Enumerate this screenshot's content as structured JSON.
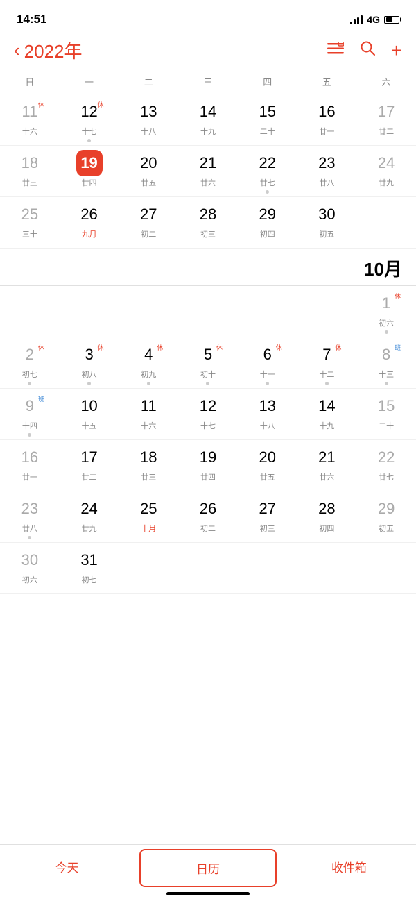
{
  "statusBar": {
    "time": "14:51",
    "signal": "4G"
  },
  "header": {
    "backLabel": "‹",
    "yearLabel": "2022年",
    "icons": {
      "list": "☰",
      "search": "⌕",
      "add": "+"
    }
  },
  "weekdays": [
    "日",
    "一",
    "二",
    "三",
    "四",
    "五",
    "六"
  ],
  "september": {
    "monthLabel": "",
    "weeks": [
      [
        {
          "day": "11",
          "lunar": "十六",
          "gray": true,
          "badge": "休",
          "dot": false
        },
        {
          "day": "12",
          "lunar": "十七",
          "gray": false,
          "badge": "休",
          "dot": true
        },
        {
          "day": "13",
          "lunar": "十八",
          "gray": false,
          "badge": "",
          "dot": false
        },
        {
          "day": "14",
          "lunar": "十九",
          "gray": false,
          "badge": "",
          "dot": false
        },
        {
          "day": "15",
          "lunar": "二十",
          "gray": false,
          "badge": "",
          "dot": false
        },
        {
          "day": "16",
          "lunar": "廿一",
          "gray": false,
          "badge": "",
          "dot": false
        },
        {
          "day": "17",
          "lunar": "廿二",
          "gray": true,
          "badge": "",
          "dot": false
        }
      ],
      [
        {
          "day": "18",
          "lunar": "廿三",
          "gray": true,
          "badge": "",
          "dot": false
        },
        {
          "day": "19",
          "lunar": "廿四",
          "gray": false,
          "badge": "",
          "today": true,
          "dot": false
        },
        {
          "day": "20",
          "lunar": "廿五",
          "gray": false,
          "badge": "",
          "dot": false
        },
        {
          "day": "21",
          "lunar": "廿六",
          "gray": false,
          "badge": "",
          "dot": false
        },
        {
          "day": "22",
          "lunar": "廿七",
          "gray": false,
          "badge": "",
          "dot": true
        },
        {
          "day": "23",
          "lunar": "廿八",
          "gray": false,
          "badge": "",
          "dot": false
        },
        {
          "day": "24",
          "lunar": "廿九",
          "gray": true,
          "badge": "",
          "dot": false
        }
      ],
      [
        {
          "day": "25",
          "lunar": "三十",
          "gray": true,
          "badge": "",
          "dot": false
        },
        {
          "day": "26",
          "lunar": "九月",
          "gray": false,
          "badge": "",
          "redLunar": true,
          "dot": false
        },
        {
          "day": "27",
          "lunar": "初二",
          "gray": false,
          "badge": "",
          "dot": false
        },
        {
          "day": "28",
          "lunar": "初三",
          "gray": false,
          "badge": "",
          "dot": false
        },
        {
          "day": "29",
          "lunar": "初四",
          "gray": false,
          "badge": "",
          "dot": false
        },
        {
          "day": "30",
          "lunar": "初五",
          "gray": false,
          "badge": "",
          "dot": false
        },
        {
          "day": "",
          "lunar": "",
          "gray": true,
          "badge": "",
          "dot": false,
          "empty": true
        }
      ]
    ]
  },
  "october": {
    "monthLabel": "10月",
    "weeks": [
      [
        {
          "day": "",
          "lunar": "",
          "empty": true,
          "dot": false
        },
        {
          "day": "",
          "lunar": "",
          "empty": true,
          "dot": false
        },
        {
          "day": "",
          "lunar": "",
          "empty": true,
          "dot": false
        },
        {
          "day": "",
          "lunar": "",
          "empty": true,
          "dot": false
        },
        {
          "day": "",
          "lunar": "",
          "empty": true,
          "dot": false
        },
        {
          "day": "",
          "lunar": "",
          "empty": true,
          "dot": false
        },
        {
          "day": "1",
          "lunar": "初六",
          "gray": true,
          "badge": "休",
          "dot": true
        }
      ],
      [
        {
          "day": "2",
          "lunar": "初七",
          "gray": true,
          "badge": "休",
          "dot": true
        },
        {
          "day": "3",
          "lunar": "初八",
          "gray": false,
          "badge": "休",
          "dot": true
        },
        {
          "day": "4",
          "lunar": "初九",
          "gray": false,
          "badge": "休",
          "dot": true
        },
        {
          "day": "5",
          "lunar": "初十",
          "gray": false,
          "badge": "休",
          "dot": true
        },
        {
          "day": "6",
          "lunar": "十一",
          "gray": false,
          "badge": "休",
          "dot": true
        },
        {
          "day": "7",
          "lunar": "十二",
          "gray": false,
          "badge": "休",
          "dot": true
        },
        {
          "day": "8",
          "lunar": "十三",
          "gray": true,
          "badge": "班",
          "banBadge": true,
          "dot": true
        }
      ],
      [
        {
          "day": "9",
          "lunar": "十四",
          "gray": true,
          "badge": "班",
          "banBadge": true,
          "dot": true
        },
        {
          "day": "10",
          "lunar": "十五",
          "gray": false,
          "badge": "",
          "dot": false
        },
        {
          "day": "11",
          "lunar": "十六",
          "gray": false,
          "badge": "",
          "dot": false
        },
        {
          "day": "12",
          "lunar": "十七",
          "gray": false,
          "badge": "",
          "dot": false
        },
        {
          "day": "13",
          "lunar": "十八",
          "gray": false,
          "badge": "",
          "dot": false
        },
        {
          "day": "14",
          "lunar": "十九",
          "gray": false,
          "badge": "",
          "dot": false
        },
        {
          "day": "15",
          "lunar": "二十",
          "gray": true,
          "badge": "",
          "dot": false
        }
      ],
      [
        {
          "day": "16",
          "lunar": "廿一",
          "gray": true,
          "badge": "",
          "dot": false
        },
        {
          "day": "17",
          "lunar": "廿二",
          "gray": false,
          "badge": "",
          "dot": false
        },
        {
          "day": "18",
          "lunar": "廿三",
          "gray": false,
          "badge": "",
          "dot": false
        },
        {
          "day": "19",
          "lunar": "廿四",
          "gray": false,
          "badge": "",
          "dot": false
        },
        {
          "day": "20",
          "lunar": "廿五",
          "gray": false,
          "badge": "",
          "dot": false
        },
        {
          "day": "21",
          "lunar": "廿六",
          "gray": false,
          "badge": "",
          "dot": false
        },
        {
          "day": "22",
          "lunar": "廿七",
          "gray": true,
          "badge": "",
          "dot": false
        }
      ],
      [
        {
          "day": "23",
          "lunar": "廿八",
          "gray": true,
          "badge": "",
          "dot": true
        },
        {
          "day": "24",
          "lunar": "廿九",
          "gray": false,
          "badge": "",
          "dot": false
        },
        {
          "day": "25",
          "lunar": "十月",
          "gray": false,
          "badge": "",
          "redLunar": true,
          "dot": false
        },
        {
          "day": "26",
          "lunar": "初二",
          "gray": false,
          "badge": "",
          "dot": false
        },
        {
          "day": "27",
          "lunar": "初三",
          "gray": false,
          "badge": "",
          "dot": false
        },
        {
          "day": "28",
          "lunar": "初四",
          "gray": false,
          "badge": "",
          "dot": false
        },
        {
          "day": "29",
          "lunar": "初五",
          "gray": true,
          "badge": "",
          "dot": false
        }
      ],
      [
        {
          "day": "30",
          "lunar": "初六",
          "gray": true,
          "badge": "",
          "dot": false
        },
        {
          "day": "31",
          "lunar": "初七",
          "gray": false,
          "badge": "",
          "dot": false
        },
        {
          "day": "",
          "lunar": "",
          "empty": true,
          "dot": false
        },
        {
          "day": "",
          "lunar": "",
          "empty": true,
          "dot": false
        },
        {
          "day": "",
          "lunar": "",
          "empty": true,
          "dot": false
        },
        {
          "day": "",
          "lunar": "",
          "empty": true,
          "dot": false
        },
        {
          "day": "",
          "lunar": "",
          "empty": true,
          "dot": false
        }
      ]
    ]
  },
  "tabBar": {
    "today": "今天",
    "calendar": "日历",
    "inbox": "收件箱"
  }
}
